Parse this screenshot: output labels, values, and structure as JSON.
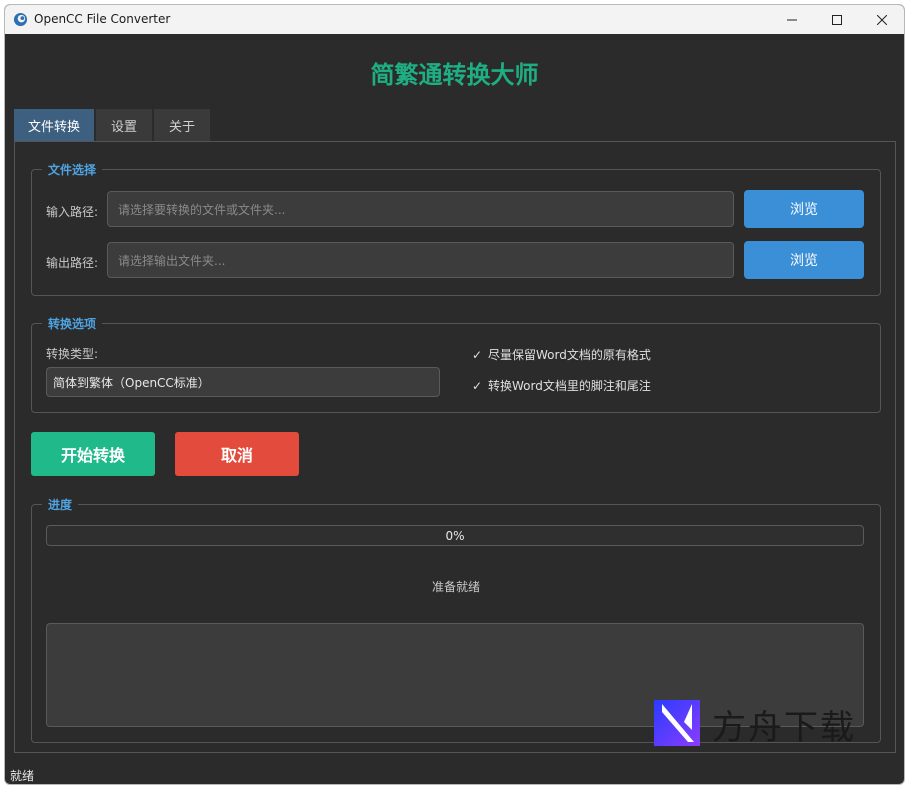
{
  "window": {
    "title": "OpenCC File Converter"
  },
  "heading": "简繁通转换大师",
  "tabs": [
    {
      "label": "文件转换",
      "active": true
    },
    {
      "label": "设置",
      "active": false
    },
    {
      "label": "关于",
      "active": false
    }
  ],
  "file_selection": {
    "group_title": "文件选择",
    "input_label": "输入路径:",
    "input_placeholder": "请选择要转换的文件或文件夹...",
    "output_label": "输出路径:",
    "output_placeholder": "请选择输出文件夹...",
    "browse_label": "浏览"
  },
  "options": {
    "group_title": "转换选项",
    "type_label": "转换类型:",
    "type_value": "简体到繁体（OpenCC标准）",
    "check1": "尽量保留Word文档的原有格式",
    "check2": "转换Word文档里的脚注和尾注",
    "check_mark": "✓"
  },
  "actions": {
    "start": "开始转换",
    "cancel": "取消"
  },
  "progress": {
    "group_title": "进度",
    "percent_text": "0%",
    "value": 0,
    "status": "准备就绪"
  },
  "statusbar": "就绪",
  "watermark": {
    "text": "方舟下载"
  },
  "colors": {
    "accent": "#1fae82",
    "browse": "#3a8fd6",
    "start": "#1fb98a",
    "cancel": "#e34c3c",
    "tab_active": "#3d5f80"
  }
}
